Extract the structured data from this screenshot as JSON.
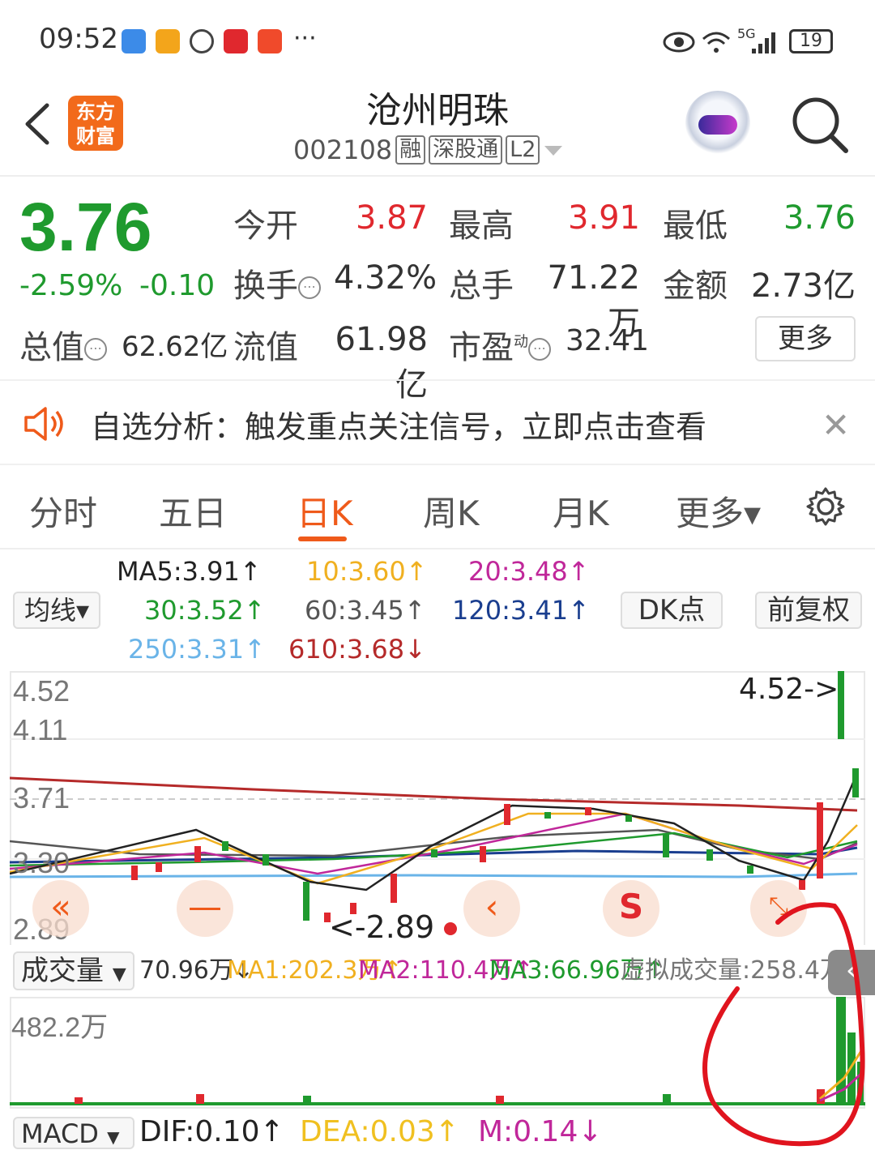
{
  "status_bar": {
    "time": "09:52",
    "signal": "5G",
    "battery": "19"
  },
  "header": {
    "logo_line1": "东方",
    "logo_line2": "财富",
    "stock_name": "沧州明珠",
    "stock_code": "002108",
    "tags": [
      "融",
      "深股通",
      "L2"
    ]
  },
  "quote": {
    "price": "3.76",
    "change_pct": "-2.59%",
    "change_abs": "-0.10",
    "open_label": "今开",
    "open": "3.87",
    "high_label": "最高",
    "high": "3.91",
    "low_label": "最低",
    "low": "3.76",
    "turnover_label": "换手",
    "turnover": "4.32%",
    "volume_label": "总手",
    "volume": "71.22万",
    "amount_label": "金额",
    "amount": "2.73亿",
    "mktcap_label": "总值",
    "mktcap": "62.62亿",
    "float_label": "流值",
    "float": "61.98亿",
    "pe_label": "市盈",
    "pe_super": "动",
    "pe": "32.41",
    "more_label": "更多"
  },
  "banner": {
    "text": "自选分析：触发重点关注信号，立即点击查看"
  },
  "tabs": [
    {
      "label": "分时"
    },
    {
      "label": "五日"
    },
    {
      "label": "日K"
    },
    {
      "label": "周K"
    },
    {
      "label": "月K"
    },
    {
      "label": "更多▾"
    }
  ],
  "ma": {
    "selector": "均线▾",
    "ma5": "MA5:3.91↑",
    "ma10": "10:3.60↑",
    "ma20": "20:3.48↑",
    "ma30": "30:3.52↑",
    "ma60": "60:3.45↑",
    "ma120": "120:3.41↑",
    "ma250": "250:3.31↑",
    "ma610": "610:3.68↓",
    "dk_label": "DK点",
    "adjust_label": "前复权"
  },
  "chart": {
    "y_top": "4.52",
    "y_2": "4.11",
    "y_3": "3.71",
    "y_4": "3.30",
    "y_bottom": "2.89",
    "high_marker": "4.52->",
    "low_marker": "<-2.89",
    "prev_btn": "«",
    "minus_btn": "—",
    "left_btn": "‹",
    "s_btn": "S",
    "colors": {
      "up": "#e0282e",
      "down": "#1f9a2e",
      "accent": "#ef5a1a"
    }
  },
  "volume": {
    "selector": "成交量",
    "current": "70.96万↓",
    "ma1": "MA1:202.3万↑",
    "ma2": "MA2:110.4万↑",
    "ma3": "MA3:66.96万↑",
    "virtual": "虚拟成交量:258.4万",
    "y_top": "482.2万"
  },
  "macd": {
    "selector": "MACD",
    "dif": "DIF:0.10↑",
    "dea": "DEA:0.03↑",
    "m": "M:0.14↓"
  },
  "side_tab": "‹"
}
